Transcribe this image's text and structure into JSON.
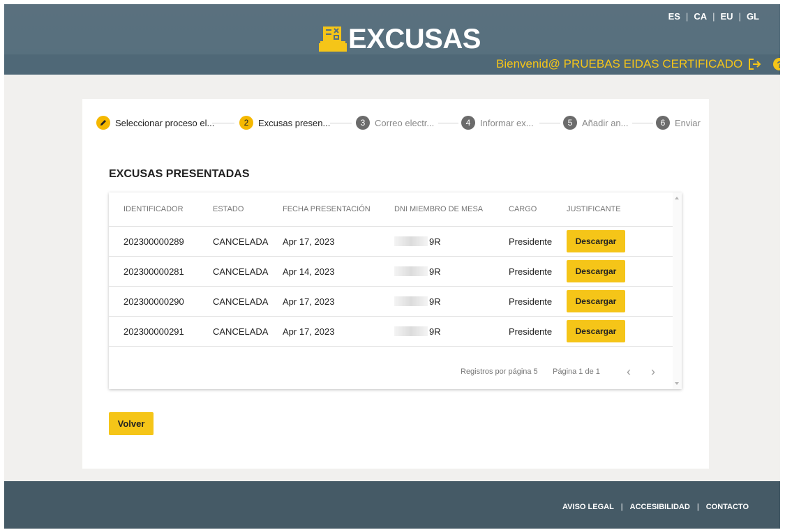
{
  "header": {
    "brand": "EXCUSAS",
    "languages": [
      "ES",
      "CA",
      "EU",
      "GL"
    ],
    "welcome": "Bienvenid@ PRUEBAS EIDAS CERTIFICADO",
    "help_symbol": "?"
  },
  "stepper": {
    "steps": [
      {
        "number": "",
        "label": "Seleccionar proceso el...",
        "state": "done",
        "icon": "pencil-icon"
      },
      {
        "number": "2",
        "label": "Excusas presen...",
        "state": "active"
      },
      {
        "number": "3",
        "label": "Correo electr...",
        "state": "pending"
      },
      {
        "number": "4",
        "label": "Informar ex...",
        "state": "pending"
      },
      {
        "number": "5",
        "label": "Añadir an...",
        "state": "pending"
      },
      {
        "number": "6",
        "label": "Enviar",
        "state": "pending"
      }
    ]
  },
  "section_title": "EXCUSAS PRESENTADAS",
  "table": {
    "columns": [
      "IDENTIFICADOR",
      "ESTADO",
      "FECHA PRESENTACIÓN",
      "DNI MIEMBRO DE MESA",
      "CARGO",
      "JUSTIFICANTE"
    ],
    "rows": [
      {
        "id": "202300000289",
        "estado": "CANCELADA",
        "fecha": "Apr 17, 2023",
        "dni": "9R",
        "cargo": "Presidente",
        "action": "Descargar"
      },
      {
        "id": "202300000281",
        "estado": "CANCELADA",
        "fecha": "Apr 14, 2023",
        "dni": "9R",
        "cargo": "Presidente",
        "action": "Descargar"
      },
      {
        "id": "202300000290",
        "estado": "CANCELADA",
        "fecha": "Apr 17, 2023",
        "dni": "9R",
        "cargo": "Presidente",
        "action": "Descargar"
      },
      {
        "id": "202300000291",
        "estado": "CANCELADA",
        "fecha": "Apr 17, 2023",
        "dni": "9R",
        "cargo": "Presidente",
        "action": "Descargar"
      }
    ],
    "pagination": {
      "per_page_label": "Registros por página 5",
      "page_label": "Página 1 de 1",
      "prev": "‹",
      "next": "›"
    }
  },
  "buttons": {
    "back": "Volver"
  },
  "footer": {
    "links": [
      "AVISO LEGAL",
      "ACCESIBILIDAD",
      "CONTACTO"
    ]
  },
  "colors": {
    "accent": "#f5c518",
    "header": "#57707e",
    "footer": "#455a66"
  }
}
